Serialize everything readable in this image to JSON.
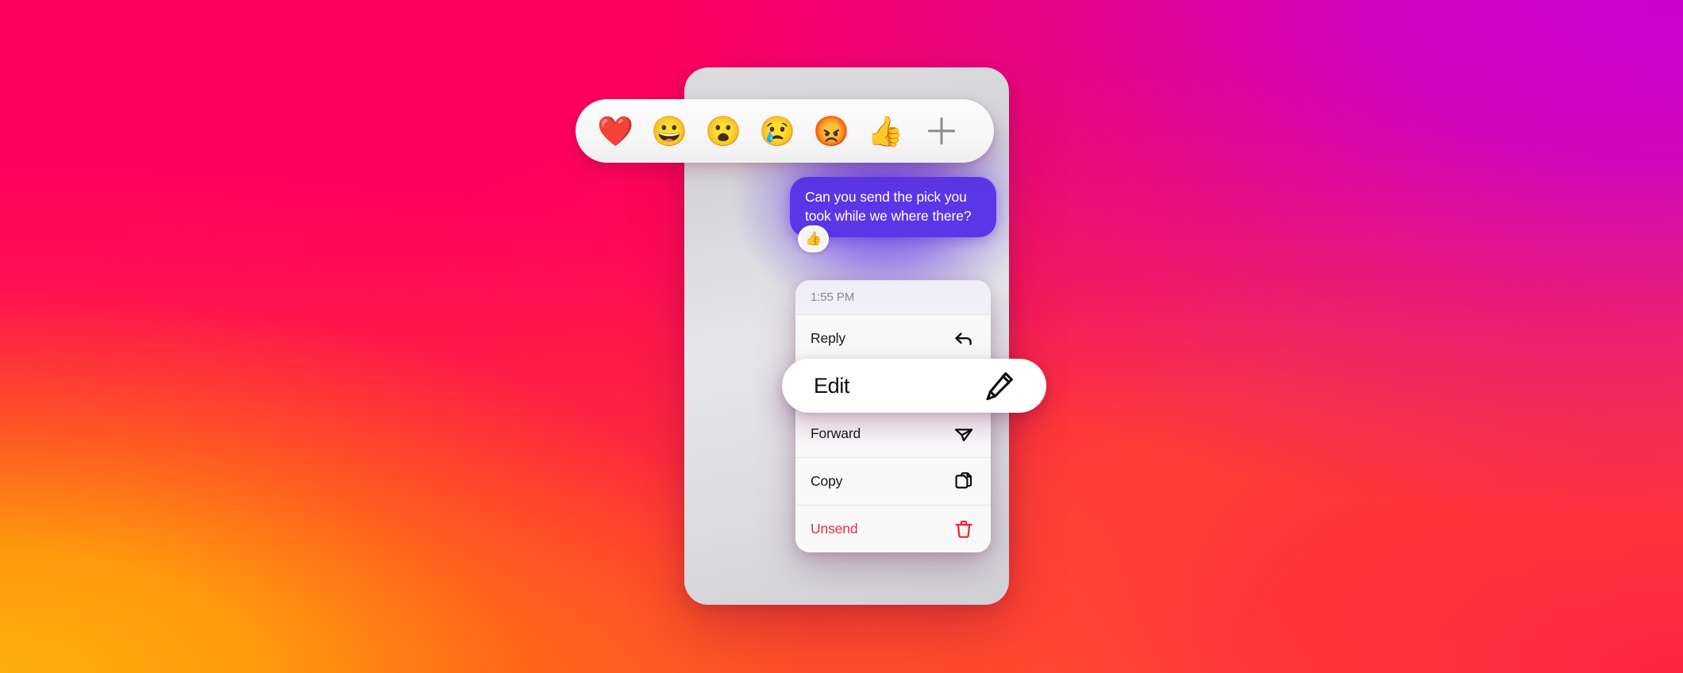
{
  "background": {
    "colors": {
      "top_left_pink": "#ff0060",
      "top_right_magenta": "#cc00cf",
      "bottom_left_orange": "#ffa80c",
      "bottom_right_red": "#ff2442"
    }
  },
  "reaction_bar": {
    "emojis": [
      {
        "name": "heart-emoji",
        "glyph": "❤️"
      },
      {
        "name": "grinning-face-emoji",
        "glyph": "😀"
      },
      {
        "name": "surprised-face-emoji",
        "glyph": "😮"
      },
      {
        "name": "crying-face-emoji",
        "glyph": "😢"
      },
      {
        "name": "angry-face-emoji",
        "glyph": "😡"
      },
      {
        "name": "thumbs-up-emoji",
        "glyph": "👍"
      }
    ],
    "add_button_label": "+"
  },
  "conversation": {
    "message": {
      "text": "Can you send the pick you took while we where there?",
      "bubble_color": "#5b36e8",
      "text_color": "#ffffff",
      "reaction": "👍"
    }
  },
  "context_menu": {
    "timestamp": "1:55 PM",
    "items": [
      {
        "label": "Reply",
        "icon": "reply-arrow-icon",
        "destructive": false
      },
      {
        "label": "Edit",
        "icon": "pencil-icon",
        "destructive": false
      },
      {
        "label": "Forward",
        "icon": "paper-plane-icon",
        "destructive": false
      },
      {
        "label": "Copy",
        "icon": "copy-pages-icon",
        "destructive": false
      },
      {
        "label": "Unsend",
        "icon": "trash-icon",
        "destructive": true
      }
    ],
    "highlighted_item": "Edit",
    "destructive_color": "#ec2b33"
  }
}
